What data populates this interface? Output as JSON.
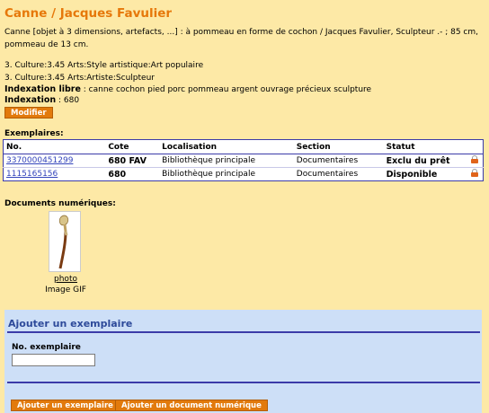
{
  "page_title": "Canne / Jacques Favulier",
  "description": "Canne [objet à 3 dimensions, artefacts, ...] : à pommeau en forme de cochon / Jacques Favulier, Sculpteur  .-  ; 85 cm, pommeau de 13 cm.",
  "culture_lines": [
    "3. Culture:3.45 Arts:Style artistique:Art populaire",
    "3. Culture:3.45 Arts:Artiste:Sculpteur"
  ],
  "indexation_libre": {
    "label": "Indexation libre",
    "value": " : canne cochon pied porc pommeau argent ouvrage précieux sculpture"
  },
  "indexation": {
    "label": "Indexation",
    "value": " : 680"
  },
  "modify_button": "Modifier",
  "exemplaires": {
    "heading": "Exemplaires:",
    "columns": [
      "No.",
      "Cote",
      "Localisation",
      "Section",
      "Statut"
    ],
    "rows": [
      {
        "no": "3370000451299",
        "cote": "680 FAV",
        "localisation": "Bibliothèque principale",
        "section": "Documentaires",
        "statut": "Exclu du prêt",
        "icon": "lock-icon"
      },
      {
        "no": "1115165156",
        "cote": "680",
        "localisation": "Bibliothèque principale",
        "section": "Documentaires",
        "statut": "Disponible",
        "icon": "lock-icon"
      }
    ]
  },
  "documents": {
    "heading": "Documents numériques:",
    "items": [
      {
        "link": "photo",
        "type": "Image GIF"
      }
    ]
  },
  "add_form": {
    "title": "Ajouter un exemplaire",
    "field_label": "No. exemplaire",
    "field_value": "",
    "button_add_copy": "Ajouter un exemplaire",
    "button_add_doc": "Ajouter un document numérique"
  },
  "colors": {
    "background": "#fde9a6",
    "title": "#e6780a",
    "button": "#e27a0c",
    "table_border": "#3b3ba8",
    "link": "#3344bb",
    "panel": "#cddff7"
  }
}
